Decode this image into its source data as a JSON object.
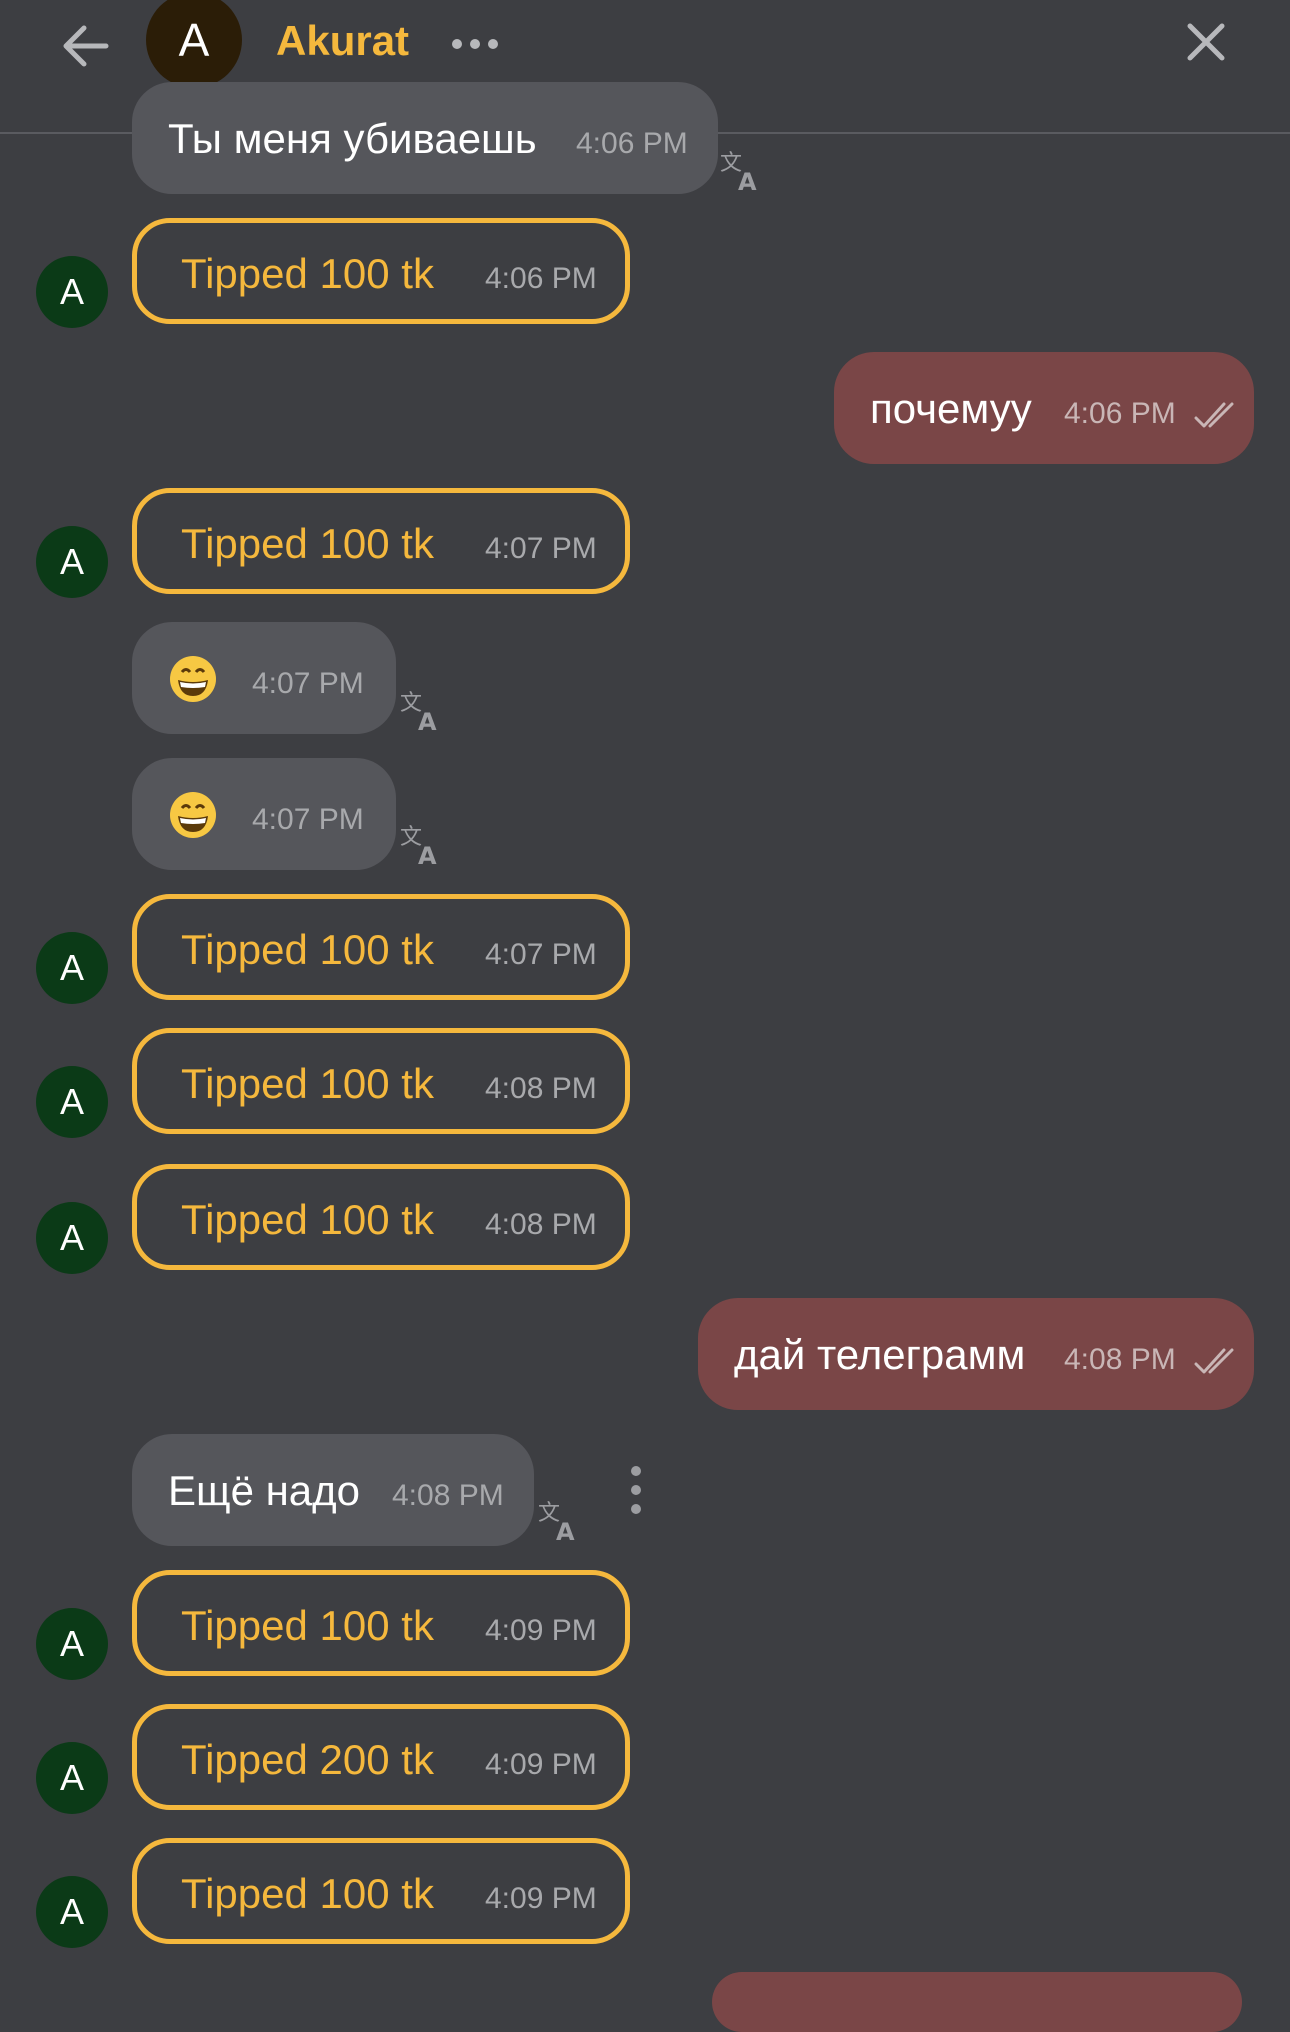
{
  "header": {
    "avatar_letter": "A",
    "title": "Akurat",
    "back_icon": "arrow-left-icon",
    "more_icon": "more-horizontal-icon",
    "close_icon": "close-icon"
  },
  "colors": {
    "background": "#3d3e42",
    "accent": "#f5b83d",
    "incoming_bubble": "#55565b",
    "outgoing_bubble": "#7a4647",
    "tipper_avatar": "#0b3a17"
  },
  "messages": [
    {
      "kind": "incoming",
      "text": "Ты меня убиваешь",
      "time": "4:06 PM"
    },
    {
      "kind": "tip",
      "avatar": "A",
      "text": "Tipped 100 tk",
      "time": "4:06 PM"
    },
    {
      "kind": "outgoing",
      "text": "почемуу",
      "time": "4:06 PM"
    },
    {
      "kind": "tip",
      "avatar": "A",
      "text": "Tipped 100 tk",
      "time": "4:07 PM"
    },
    {
      "kind": "incoming",
      "emoji": "grinning-face",
      "time": "4:07 PM"
    },
    {
      "kind": "incoming",
      "emoji": "grinning-face",
      "time": "4:07 PM"
    },
    {
      "kind": "tip",
      "avatar": "A",
      "text": "Tipped 100 tk",
      "time": "4:07 PM"
    },
    {
      "kind": "tip",
      "avatar": "A",
      "text": "Tipped 100 tk",
      "time": "4:08 PM"
    },
    {
      "kind": "tip",
      "avatar": "A",
      "text": "Tipped 100 tk",
      "time": "4:08 PM"
    },
    {
      "kind": "outgoing",
      "text": "дай телеграмм",
      "time": "4:08 PM"
    },
    {
      "kind": "incoming",
      "text": "Ещё надо",
      "time": "4:08 PM"
    },
    {
      "kind": "tip",
      "avatar": "A",
      "text": "Tipped 100 tk",
      "time": "4:09 PM"
    },
    {
      "kind": "tip",
      "avatar": "A",
      "text": "Tipped 200 tk",
      "time": "4:09 PM"
    },
    {
      "kind": "tip",
      "avatar": "A",
      "text": "Tipped 100 tk",
      "time": "4:09 PM"
    }
  ]
}
